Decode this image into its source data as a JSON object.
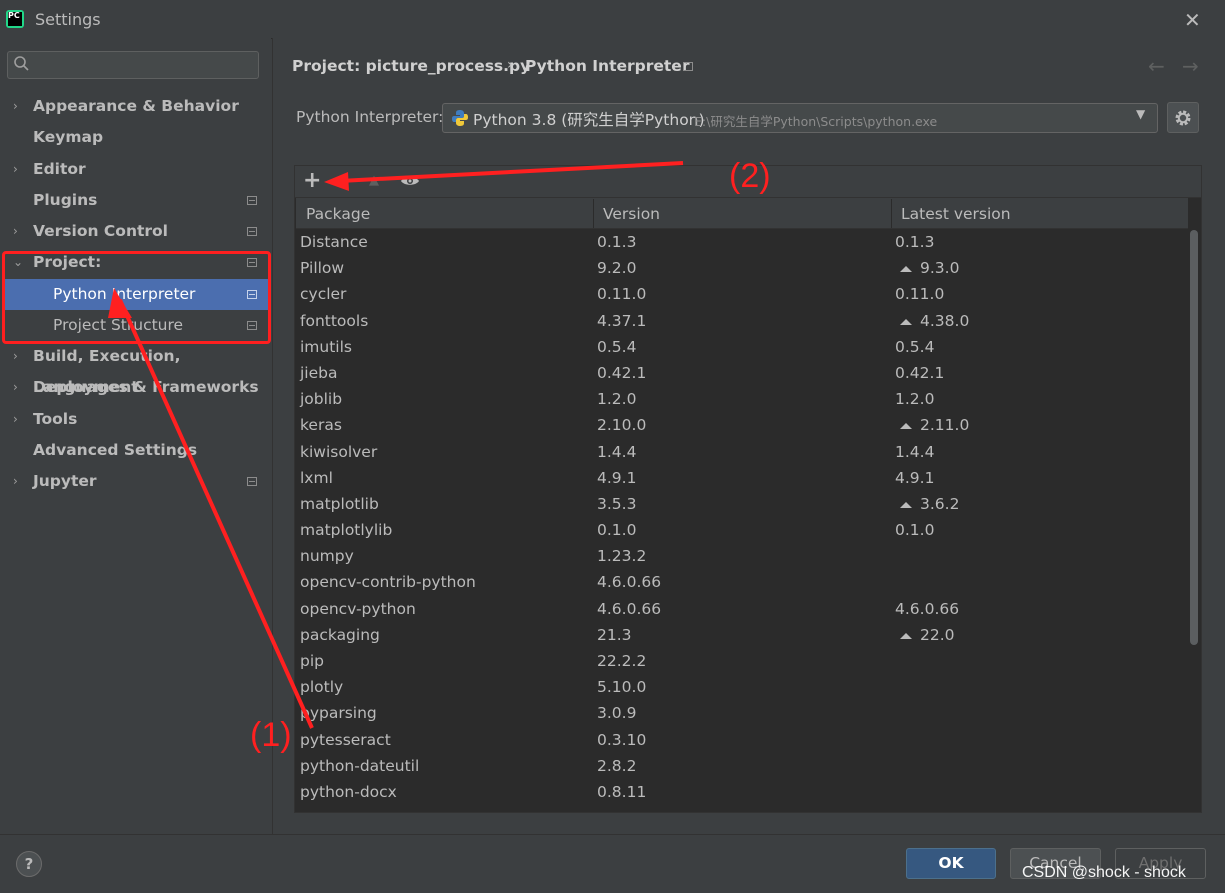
{
  "window": {
    "title": "Settings",
    "app_icon_text": "PC"
  },
  "sidebar": {
    "search_placeholder": "",
    "items": [
      {
        "label": "Appearance & Behavior",
        "chevron": "›"
      },
      {
        "label": "Keymap"
      },
      {
        "label": "Editor",
        "chevron": "›"
      },
      {
        "label": "Plugins"
      },
      {
        "label": "Version Control",
        "chevron": "›"
      },
      {
        "label": "Project: picture_process.py",
        "chevron": "⌄"
      },
      {
        "label": "Python Interpreter"
      },
      {
        "label": "Project Structure"
      },
      {
        "label": "Build, Execution, Deployment",
        "chevron": "›"
      },
      {
        "label": "Languages & Frameworks",
        "chevron": "›"
      },
      {
        "label": "Tools",
        "chevron": "›"
      },
      {
        "label": "Advanced Settings"
      },
      {
        "label": "Jupyter",
        "chevron": "›"
      }
    ]
  },
  "breadcrumb": {
    "project": "Project: picture_process.py",
    "separator": "›",
    "page": "Python Interpreter"
  },
  "nav_arrows": {
    "back": "←",
    "forward": "→"
  },
  "interpreter": {
    "label": "Python Interpreter:",
    "name": "Python 3.8 (研究生自学Python)",
    "path": "E:\\研究生自学Python\\Scripts\\python.exe",
    "chevron": "▼"
  },
  "toolbar": {
    "add": "+",
    "upgrade": "▲"
  },
  "table": {
    "headers": [
      "Package",
      "Version",
      "Latest version"
    ],
    "rows": [
      {
        "package": "Distance",
        "version": "0.1.3",
        "latest": "0.1.3",
        "upgrade": false
      },
      {
        "package": "Pillow",
        "version": "9.2.0",
        "latest": "9.3.0",
        "upgrade": true
      },
      {
        "package": "cycler",
        "version": "0.11.0",
        "latest": "0.11.0",
        "upgrade": false
      },
      {
        "package": "fonttools",
        "version": "4.37.1",
        "latest": "4.38.0",
        "upgrade": true
      },
      {
        "package": "imutils",
        "version": "0.5.4",
        "latest": "0.5.4",
        "upgrade": false
      },
      {
        "package": "jieba",
        "version": "0.42.1",
        "latest": "0.42.1",
        "upgrade": false
      },
      {
        "package": "joblib",
        "version": "1.2.0",
        "latest": "1.2.0",
        "upgrade": false
      },
      {
        "package": "keras",
        "version": "2.10.0",
        "latest": "2.11.0",
        "upgrade": true
      },
      {
        "package": "kiwisolver",
        "version": "1.4.4",
        "latest": "1.4.4",
        "upgrade": false
      },
      {
        "package": "lxml",
        "version": "4.9.1",
        "latest": "4.9.1",
        "upgrade": false
      },
      {
        "package": "matplotlib",
        "version": "3.5.3",
        "latest": "3.6.2",
        "upgrade": true
      },
      {
        "package": "matplotlylib",
        "version": "0.1.0",
        "latest": "0.1.0",
        "upgrade": false
      },
      {
        "package": "numpy",
        "version": "1.23.2",
        "latest": "",
        "upgrade": false
      },
      {
        "package": "opencv-contrib-python",
        "version": "4.6.0.66",
        "latest": "",
        "upgrade": false
      },
      {
        "package": "opencv-python",
        "version": "4.6.0.66",
        "latest": "4.6.0.66",
        "upgrade": false
      },
      {
        "package": "packaging",
        "version": "21.3",
        "latest": "22.0",
        "upgrade": true
      },
      {
        "package": "pip",
        "version": "22.2.2",
        "latest": "",
        "upgrade": false
      },
      {
        "package": "plotly",
        "version": "5.10.0",
        "latest": "",
        "upgrade": false
      },
      {
        "package": "pyparsing",
        "version": "3.0.9",
        "latest": "",
        "upgrade": false
      },
      {
        "package": "pytesseract",
        "version": "0.3.10",
        "latest": "",
        "upgrade": false
      },
      {
        "package": "python-dateutil",
        "version": "2.8.2",
        "latest": "",
        "upgrade": false
      },
      {
        "package": "python-docx",
        "version": "0.8.11",
        "latest": "",
        "upgrade": false
      }
    ]
  },
  "footer": {
    "help": "?",
    "ok": "OK",
    "cancel": "Cancel",
    "apply": "Apply"
  },
  "watermark": "CSDN @shock - shock",
  "annotations": {
    "step1": "(1)",
    "step2": "(2)",
    "color": "#ff2020"
  },
  "colors": {
    "background": "#3c3f41",
    "table_bg": "#2b2b2b",
    "selection": "#4b6eaf",
    "ok_button": "#365880"
  }
}
